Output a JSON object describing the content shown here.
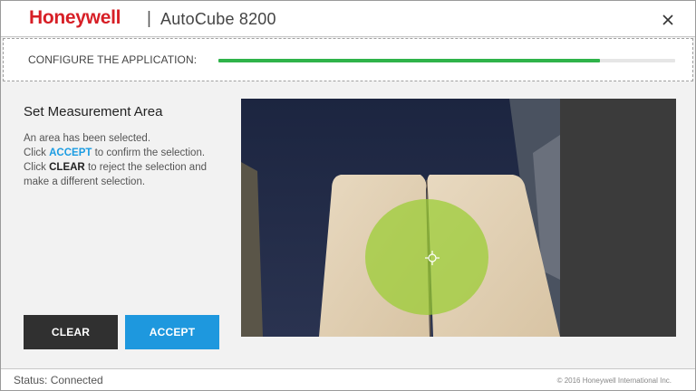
{
  "window": {
    "brand": "Honeywell",
    "separator": "|",
    "app_title": "AutoCube 8200",
    "close_icon": "close-icon"
  },
  "configure": {
    "label": "CONFIGURE THE APPLICATION:",
    "progress_fraction": 0.835,
    "progress_color": "#2fb34a"
  },
  "panel": {
    "title": "Set Measurement Area",
    "line1": "An area has been selected.",
    "line2_pre": "Click ",
    "line2_kw": "ACCEPT",
    "line2_post": " to confirm the selection.",
    "line3_pre": "Click ",
    "line3_kw": "CLEAR",
    "line3_post": " to reject the selection and make a different selection."
  },
  "buttons": {
    "clear_label": "CLEAR",
    "accept_label": "ACCEPT"
  },
  "camera": {
    "selection_color": "#9acd32",
    "crosshair_icon": "crosshair-icon"
  },
  "status": {
    "text": "Status: Connected",
    "copyright": "© 2016 Honeywell International Inc."
  }
}
